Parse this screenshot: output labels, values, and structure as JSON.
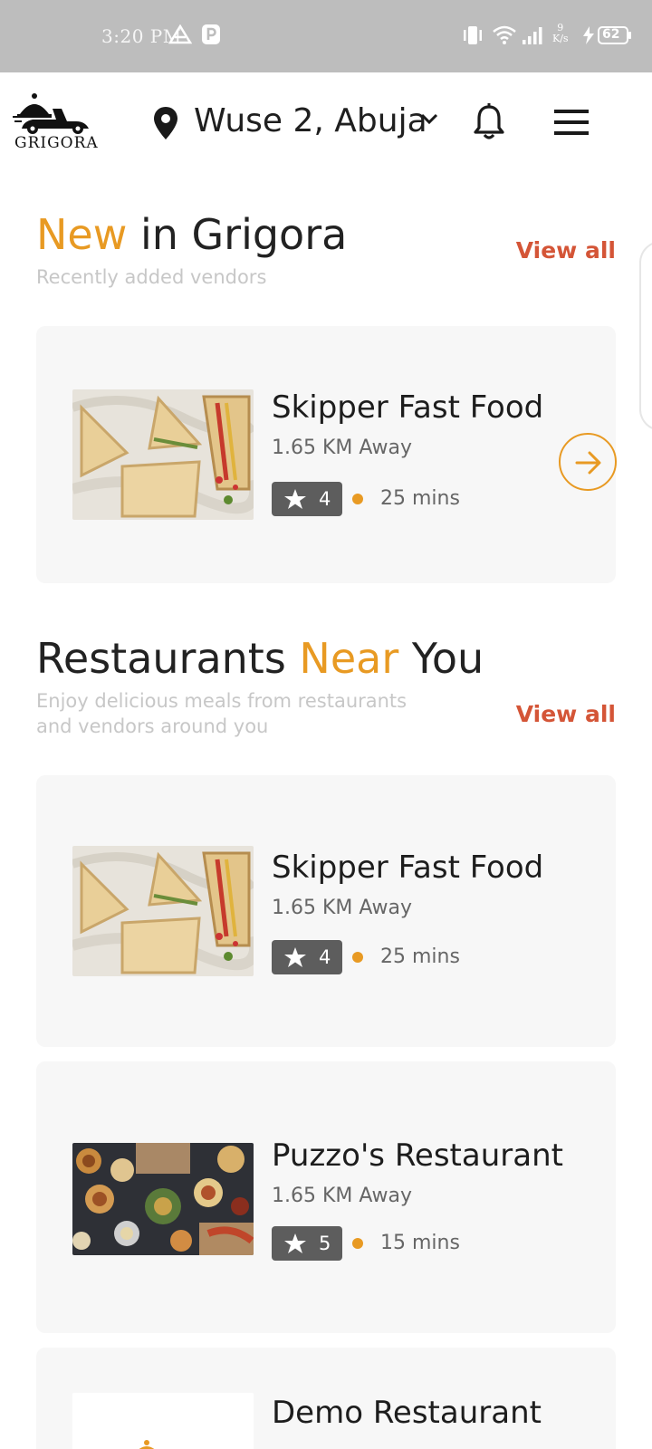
{
  "status_bar": {
    "time": "3:20 PM",
    "net_speed_top": "9",
    "net_speed_bottom": "K/s",
    "battery": "62",
    "icons": [
      "drive-icon",
      "p-icon",
      "vibrate-icon",
      "wifi-icon",
      "signal-icon",
      "charging-icon",
      "battery-icon"
    ]
  },
  "header": {
    "logo_text": "GRIGORA",
    "location": "Wuse 2, Abuja",
    "icons": [
      "location-pin-icon",
      "chevron-down-icon",
      "bell-icon",
      "menu-icon"
    ]
  },
  "new_section": {
    "title_accent": "New",
    "title_rest": " in Grigora",
    "subtitle": "Recently added vendors",
    "view_all": "View all",
    "card": {
      "name": "Skipper Fast Food",
      "distance": "1.65 KM Away",
      "rating": "4",
      "time": "25 mins"
    }
  },
  "near_section": {
    "title_start": "Restaurants ",
    "title_accent": "Near",
    "title_end": " You",
    "subtitle_line1": "Enjoy delicious meals from restaurants",
    "subtitle_line2": "and vendors around you",
    "view_all": "View all",
    "cards": [
      {
        "name": "Skipper Fast Food",
        "distance": "1.65 KM Away",
        "rating": "4",
        "time": "25 mins"
      },
      {
        "name": "Puzzo's Restaurant",
        "distance": "1.65 KM Away",
        "rating": "5",
        "time": "15 mins"
      },
      {
        "name": "Demo Restaurant"
      }
    ]
  },
  "colors": {
    "accent_orange": "#e89a23",
    "view_all_red": "#d45537",
    "rating_badge": "#5d5d5d",
    "card_bg": "#f7f7f7",
    "status_bar_bg": "#bdbdbd"
  }
}
